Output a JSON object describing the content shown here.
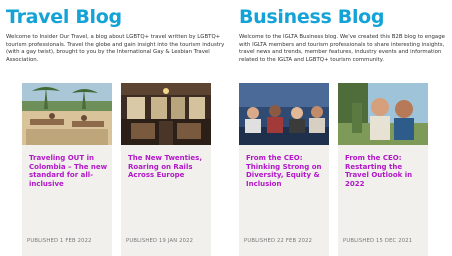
{
  "travel_blog": {
    "title": "Travel Blog",
    "description": "Welcome to Insider Our Travel, a blog about LGBTQ+ travel written by LGBTQ+ tourism professionals. Travel the globe and gain insight into the tourism industry (with a gay twist), brought to you by the International Gay & Lesbian Travel Association.",
    "posts": [
      {
        "title": "Traveling OUT in Colombia – The new standard for all-inclusive",
        "date": "PUBLISHED 1 FEB 2022"
      },
      {
        "title": "The New Twenties, Roaring on Rails Across Europe",
        "date": "PUBLISHED 19 JAN 2022"
      }
    ]
  },
  "business_blog": {
    "title": "Business Blog",
    "description": "Welcome to the IGLTA Business blog. We've created this B2B blog to engage with IGLTA members and tourism professionals to share interesting insights, travel news and trends, member features, industry events and information related to the IGLTA and LGBTQ+ tourism community.",
    "posts": [
      {
        "title": "From the CEO: Thinking Strong on Diversity, Equity & Inclusion",
        "date": "PUBLISHED 22 FEB 2022"
      },
      {
        "title": "From the CEO: Restarting the Travel Outlook in 2022",
        "date": "PUBLISHED 15 DEC 2021"
      }
    ]
  },
  "colors": {
    "heading": "#14a3d6",
    "post_title": "#b218c9",
    "card_bg": "#f2f0ec",
    "meta_text": "#777777"
  }
}
